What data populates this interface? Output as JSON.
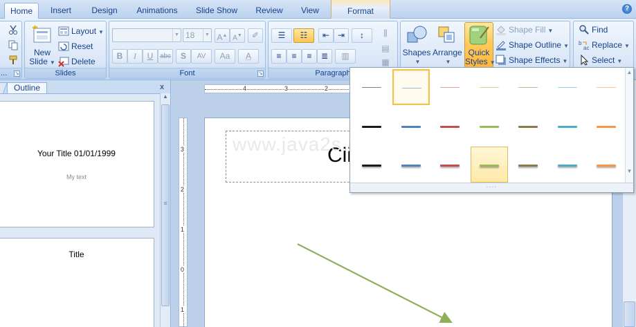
{
  "tabs": {
    "home": "Home",
    "insert": "Insert",
    "design": "Design",
    "animations": "Animations",
    "slideshow": "Slide Show",
    "review": "Review",
    "view": "View",
    "format": "Format"
  },
  "help": "?",
  "ribbon": {
    "clipboard": {
      "label_cut": "",
      "more": "..."
    },
    "slides": {
      "new_slide": "New",
      "new_slide_2": "Slide",
      "layout": "Layout",
      "reset": "Reset",
      "delete": "Delete",
      "group_label": "Slides"
    },
    "font": {
      "font_name": "",
      "font_size": "18",
      "bold": "B",
      "italic": "I",
      "underline": "U",
      "strike": "abc",
      "shadow": "S",
      "spacing": "AV",
      "case": "Aa",
      "grow": "A",
      "shrink": "A",
      "color": "A",
      "group_label": "Font"
    },
    "paragraph": {
      "group_label": "Paragraph"
    },
    "drawing": {
      "shapes": "Shapes",
      "arrange": "Arrange",
      "quick_styles_1": "Quick",
      "quick_styles_2": "Styles",
      "shape_fill": "Shape Fill",
      "shape_outline": "Shape Outline",
      "shape_effects": "Shape Effects"
    },
    "editing": {
      "find": "Find",
      "replace": "Replace",
      "select": "Select"
    }
  },
  "left_panel": {
    "outline_tab": "Outline",
    "close": "x",
    "slide1_title": "Your Title 01/01/1999",
    "slide1_text": "My text",
    "slide2_title": "Title"
  },
  "slide": {
    "title_fragment": "Cli",
    "watermark": "www.java2s.com"
  },
  "ruler": {
    "h_labels": [
      "4",
      "3",
      "2"
    ],
    "v_labels": [
      "3",
      "2",
      "1",
      "0",
      "1"
    ]
  },
  "gallery": {
    "colors": {
      "dark": "#1a1a1a",
      "blue": "#4f81bd",
      "red": "#c0504d",
      "green": "#9bbb59",
      "olive": "#8a7a4a",
      "teal": "#4bacc6",
      "orange": "#f79646",
      "gray": "#7f7f7f"
    },
    "selected_row": 2,
    "selected_col": 3,
    "highlight_row": 0,
    "highlight_col": 1
  }
}
